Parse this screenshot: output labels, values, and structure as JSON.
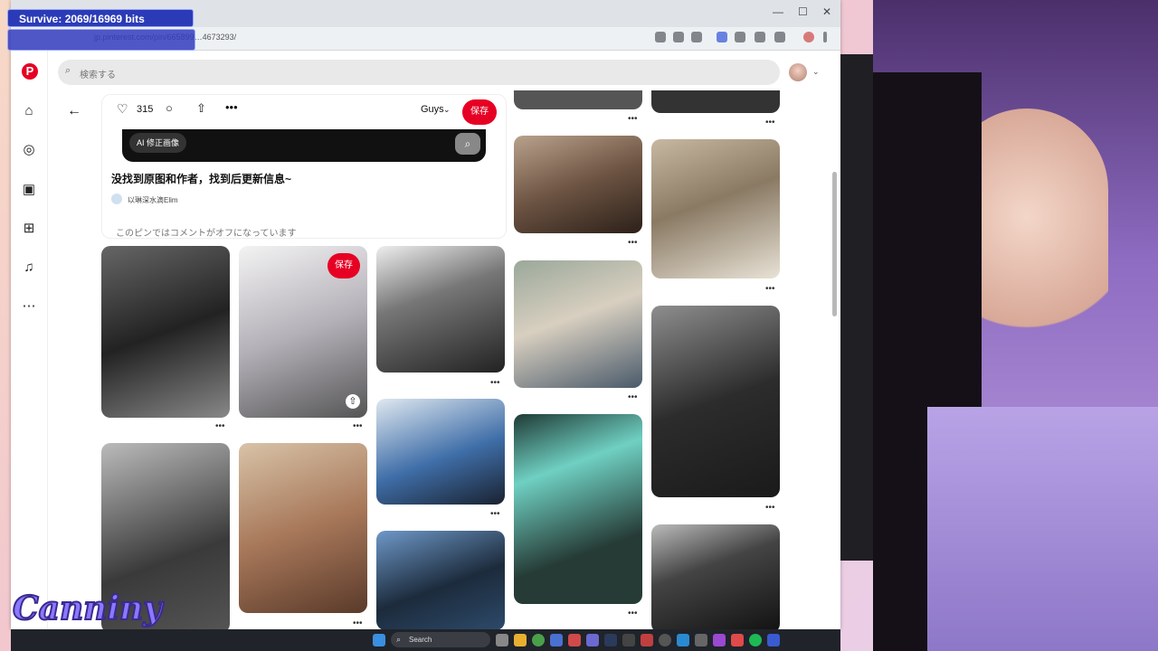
{
  "overlay": {
    "bits_goal": "Survive: 2069/16969 bits",
    "channel_logo": "Canniny"
  },
  "browser": {
    "url": "jp.pinterest.com/pin/665899…4673293/"
  },
  "pinterest": {
    "search_placeholder": "検索する",
    "detail": {
      "like_count": "315",
      "board_select": "Guys",
      "save_label": "保存",
      "ai_button": "AI 修正画像",
      "title": "没找到原图和作者，找到后更新信息~",
      "author": "以琳深水滴Elim",
      "author_initials": "以",
      "comments_off": "このピンではコメントがオフになっています"
    },
    "grid_save_label": "保存"
  },
  "taskbar": {
    "search_label": "Search"
  },
  "colors": {
    "pinterest_red": "#e60023",
    "overlay_blue": "#2b3bb8"
  }
}
